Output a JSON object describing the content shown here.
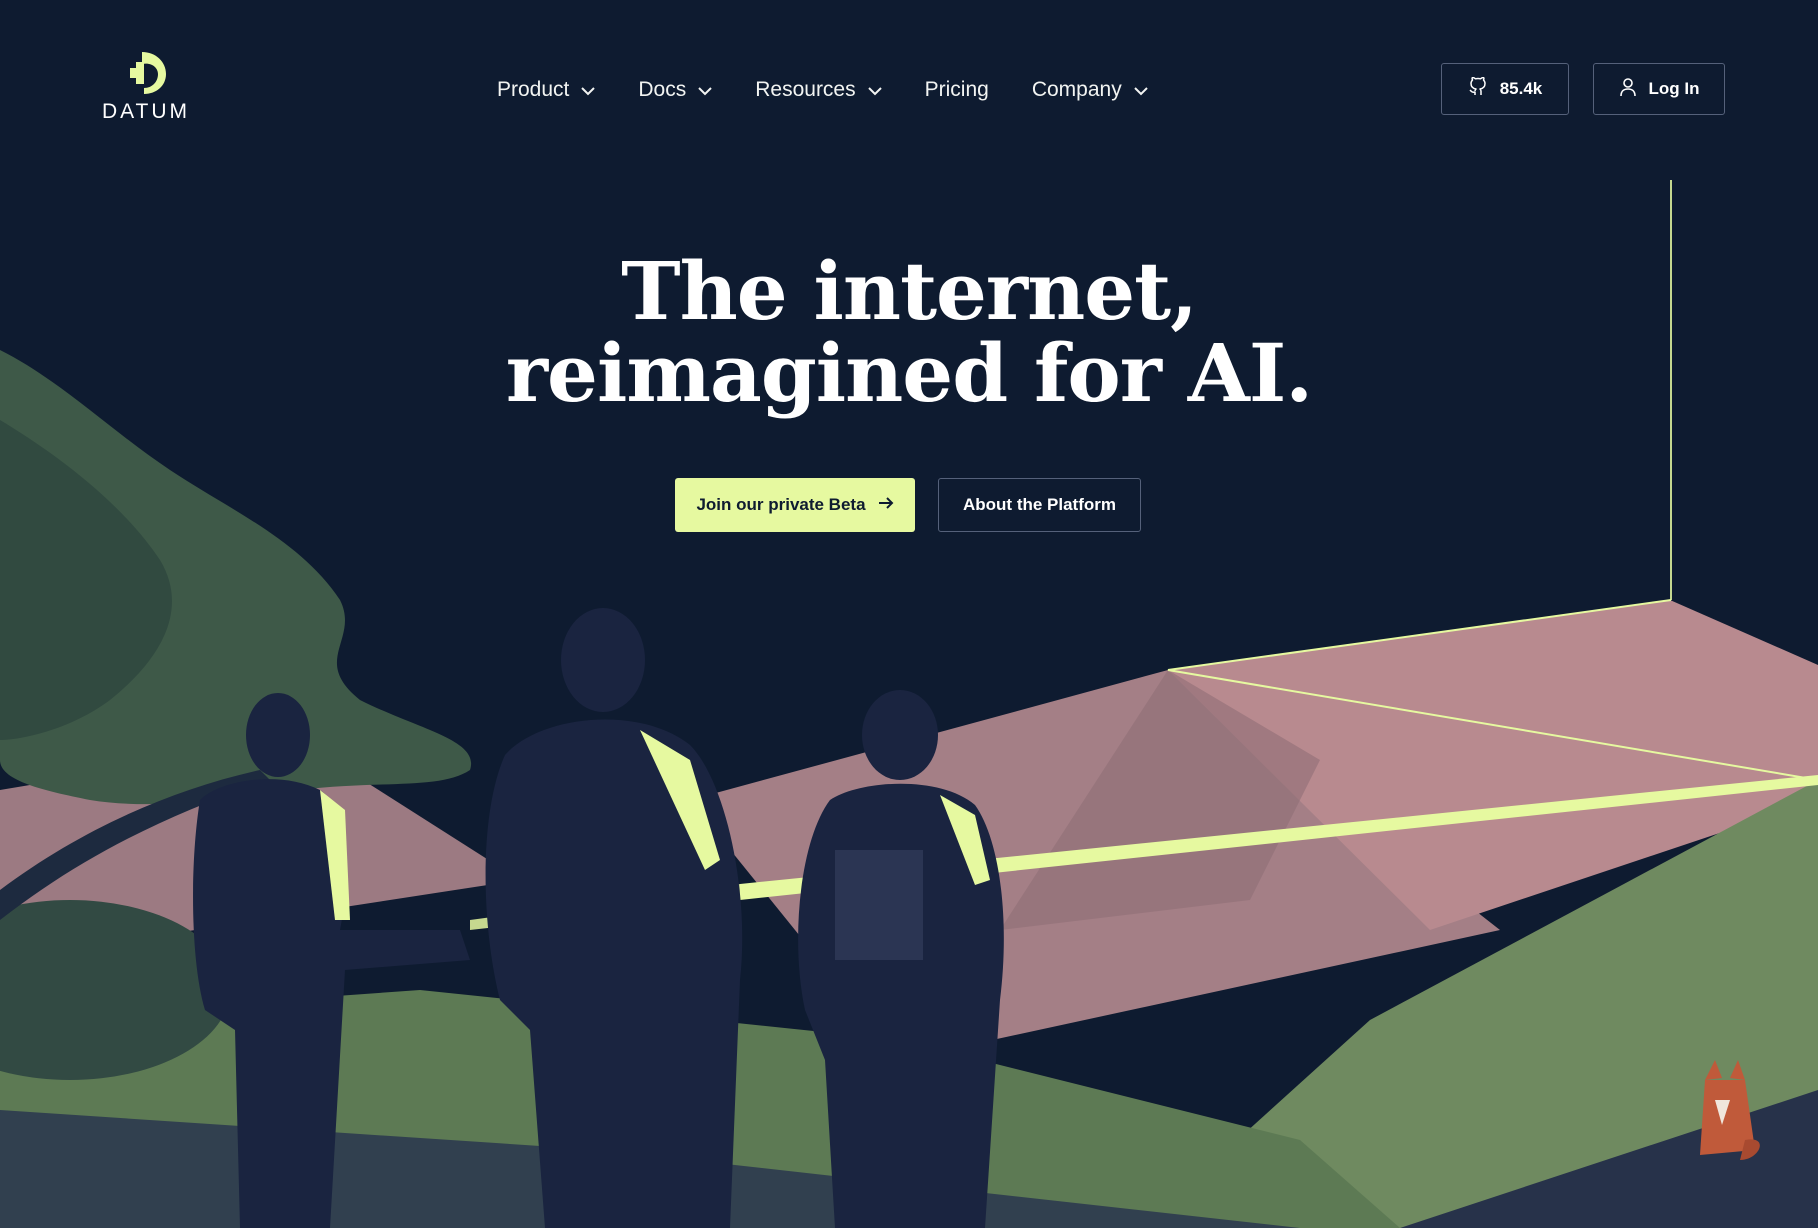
{
  "brand": {
    "name": "DATUM",
    "logo_icon": "datum-logo-icon"
  },
  "nav": {
    "items": [
      {
        "label": "Product",
        "has_dropdown": true
      },
      {
        "label": "Docs",
        "has_dropdown": true
      },
      {
        "label": "Resources",
        "has_dropdown": true
      },
      {
        "label": "Pricing",
        "has_dropdown": false
      },
      {
        "label": "Company",
        "has_dropdown": true
      }
    ]
  },
  "header_actions": {
    "github": {
      "icon": "github-icon",
      "stars": "85.4k"
    },
    "login": {
      "icon": "user-icon",
      "label": "Log In"
    }
  },
  "hero": {
    "title_line1": "The internet,",
    "title_line2": "reimagined for AI.",
    "primary_cta": {
      "label": "Join our private Beta",
      "icon": "arrow-right-icon"
    },
    "secondary_cta": {
      "label": "About the Platform"
    }
  },
  "colors": {
    "background": "#0e1b30",
    "accent": "#e6f9a0",
    "mountain_pink": "#b88a8f",
    "hill_green": "#6f8a60"
  }
}
